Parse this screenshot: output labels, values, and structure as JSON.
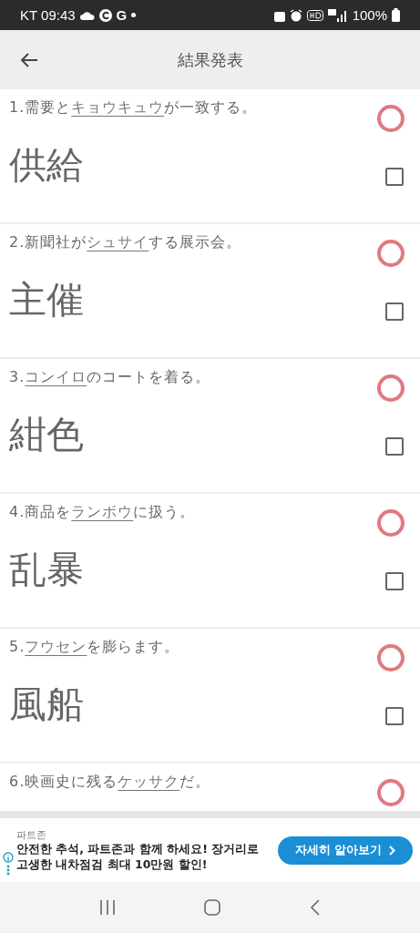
{
  "status_bar": {
    "carrier_time": "KT 09:43",
    "g": "G",
    "battery": "100%"
  },
  "header": {
    "title": "結果発表"
  },
  "questions": [
    {
      "before": "1.需要と",
      "underlined": "キョウキュウ",
      "after": "が一致する。",
      "answer": "供給",
      "kind": "correct",
      "checked": false
    },
    {
      "before": "2.新聞社が",
      "underlined": "シュサイ",
      "after": "する展示会。",
      "answer": "主催",
      "kind": "correct",
      "checked": false
    },
    {
      "before": "3.",
      "underlined": "コンイロ",
      "after": "のコートを着る。",
      "answer": "紺色",
      "kind": "correct",
      "checked": false
    },
    {
      "before": "4.商品を",
      "underlined": "ランボウ",
      "after": "に扱う。",
      "answer": "乱暴",
      "kind": "correct",
      "checked": false
    },
    {
      "before": "5.",
      "underlined": "フウセン",
      "after": "を膨らます。",
      "answer": "風船",
      "kind": "correct",
      "checked": false
    },
    {
      "before": "6.映画史に残る",
      "underlined": "ケッサク",
      "after": "だ。",
      "kind": "correct"
    }
  ],
  "ad": {
    "advertiser": "파트존",
    "text": "안전한 추석, 파트존과 함께 하세요! 장거리로 고생한 내차점검 최대 10만원 할인!",
    "button": "자세히 알아보기"
  }
}
